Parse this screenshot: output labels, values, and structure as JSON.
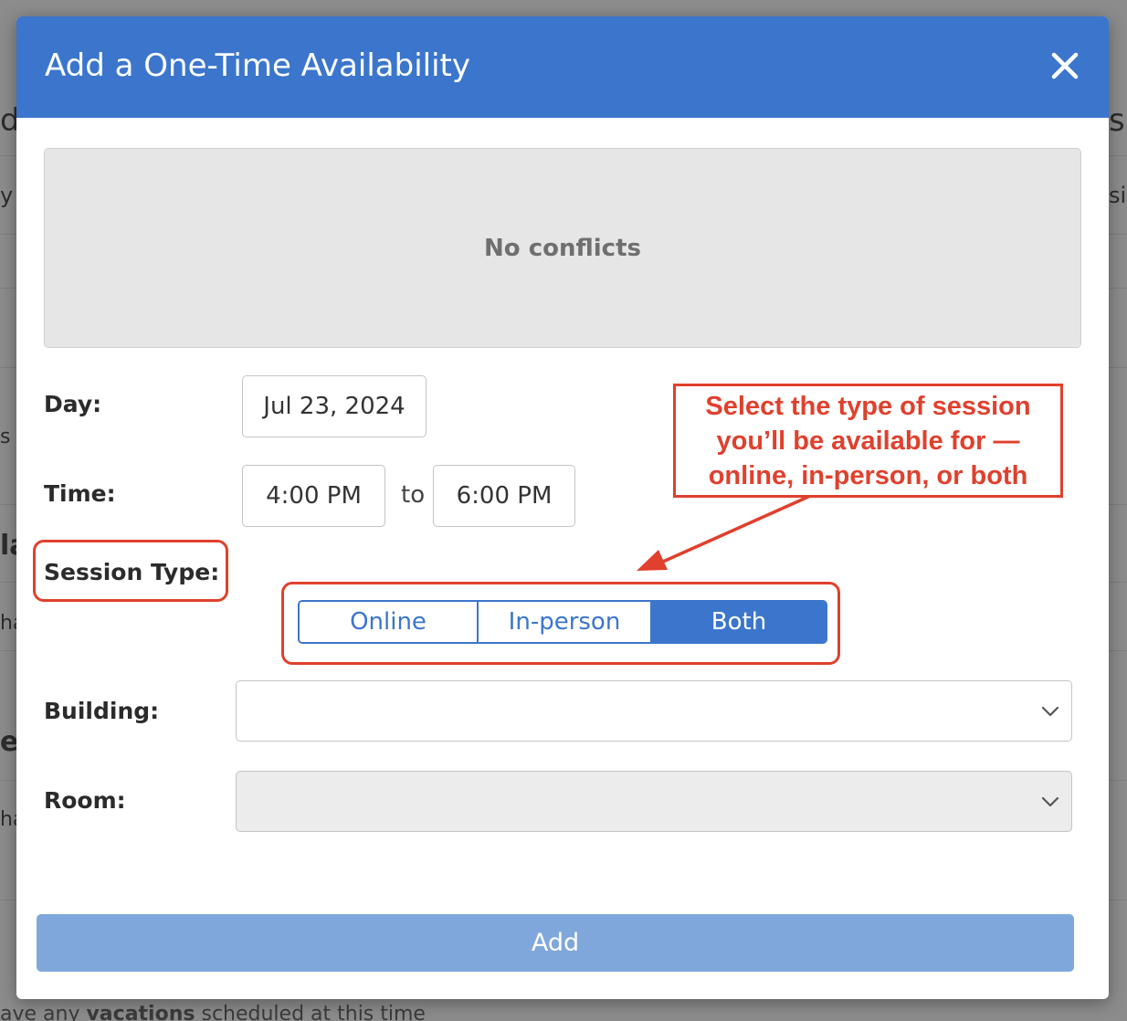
{
  "modal": {
    "title": "Add a One-Time Availability",
    "close_icon": "close-icon",
    "conflicts_text": "No conflicts",
    "day": {
      "label": "Day:",
      "value": "Jul 23, 2024"
    },
    "time": {
      "label": "Time:",
      "start": "4:00 PM",
      "separator": "to",
      "end": "6:00 PM"
    },
    "session_type": {
      "label": "Session Type:",
      "options": [
        "Online",
        "In-person",
        "Both"
      ],
      "selected": "Both"
    },
    "building": {
      "label": "Building:",
      "value": ""
    },
    "room": {
      "label": "Room:",
      "value": ""
    },
    "add_label": "Add"
  },
  "annotation": {
    "lines": [
      "Select the type of session",
      "you’ll be available for —",
      "online, in-person, or both"
    ],
    "color": "#e0402d"
  },
  "colors": {
    "header": "#3b76cc",
    "add_button": "#7fa7dc",
    "conflicts_bg": "#e6e6e6"
  },
  "background": {
    "footer_prefix": "ave any ",
    "footer_bold": "vacations",
    "footer_suffix": " scheduled at this time"
  }
}
